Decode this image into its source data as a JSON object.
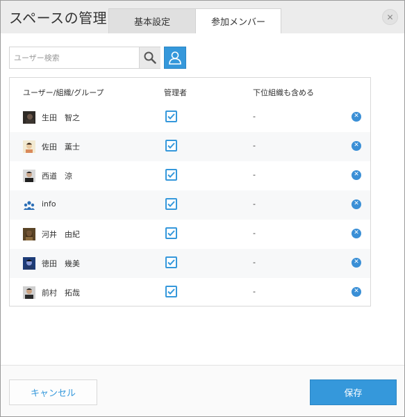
{
  "dialog": {
    "title": "スペースの管理",
    "tabs": [
      {
        "label": "基本設定",
        "active": false
      },
      {
        "label": "参加メンバー",
        "active": true
      }
    ],
    "close_icon": "close-icon"
  },
  "search": {
    "placeholder": "ユーザー検索",
    "value": "",
    "search_icon": "search-icon",
    "picker_icon": "user-icon"
  },
  "table": {
    "headers": {
      "member": "ユーザー/組織/グループ",
      "admin": "管理者",
      "include_sub": "下位組織も含める"
    },
    "rows": [
      {
        "name": "生田　智之",
        "admin": true,
        "include_sub": "-"
      },
      {
        "name": "佐田　薫士",
        "admin": true,
        "include_sub": "-"
      },
      {
        "name": "西道　涼",
        "admin": true,
        "include_sub": "-"
      },
      {
        "name": "info",
        "admin": true,
        "include_sub": "-"
      },
      {
        "name": "河井　由紀",
        "admin": true,
        "include_sub": "-"
      },
      {
        "name": "徳田　幾美",
        "admin": true,
        "include_sub": "-"
      },
      {
        "name": "前村　拓哉",
        "admin": true,
        "include_sub": "-"
      }
    ]
  },
  "footer": {
    "cancel_label": "キャンセル",
    "save_label": "保存"
  },
  "colors": {
    "accent": "#3598db",
    "remove": "#3a8fd6"
  }
}
